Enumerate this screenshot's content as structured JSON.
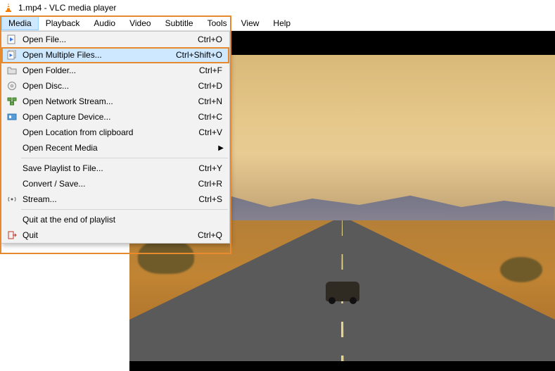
{
  "title": "1.mp4 - VLC media player",
  "menubar": [
    "Media",
    "Playback",
    "Audio",
    "Video",
    "Subtitle",
    "Tools",
    "View",
    "Help"
  ],
  "active_menu_index": 0,
  "menu": {
    "openFile": {
      "label": "Open File...",
      "short": "Ctrl+O"
    },
    "openMultiple": {
      "label": "Open Multiple Files...",
      "short": "Ctrl+Shift+O"
    },
    "openFolder": {
      "label": "Open Folder...",
      "short": "Ctrl+F"
    },
    "openDisc": {
      "label": "Open Disc...",
      "short": "Ctrl+D"
    },
    "openNetwork": {
      "label": "Open Network Stream...",
      "short": "Ctrl+N"
    },
    "openCapture": {
      "label": "Open Capture Device...",
      "short": "Ctrl+C"
    },
    "openClipboard": {
      "label": "Open Location from clipboard",
      "short": "Ctrl+V"
    },
    "openRecent": {
      "label": "Open Recent Media",
      "short": ""
    },
    "savePlaylist": {
      "label": "Save Playlist to File...",
      "short": "Ctrl+Y"
    },
    "convert": {
      "label": "Convert / Save...",
      "short": "Ctrl+R"
    },
    "stream": {
      "label": "Stream...",
      "short": "Ctrl+S"
    },
    "quitEnd": {
      "label": "Quit at the end of playlist",
      "short": ""
    },
    "quit": {
      "label": "Quit",
      "short": "Ctrl+Q"
    }
  }
}
